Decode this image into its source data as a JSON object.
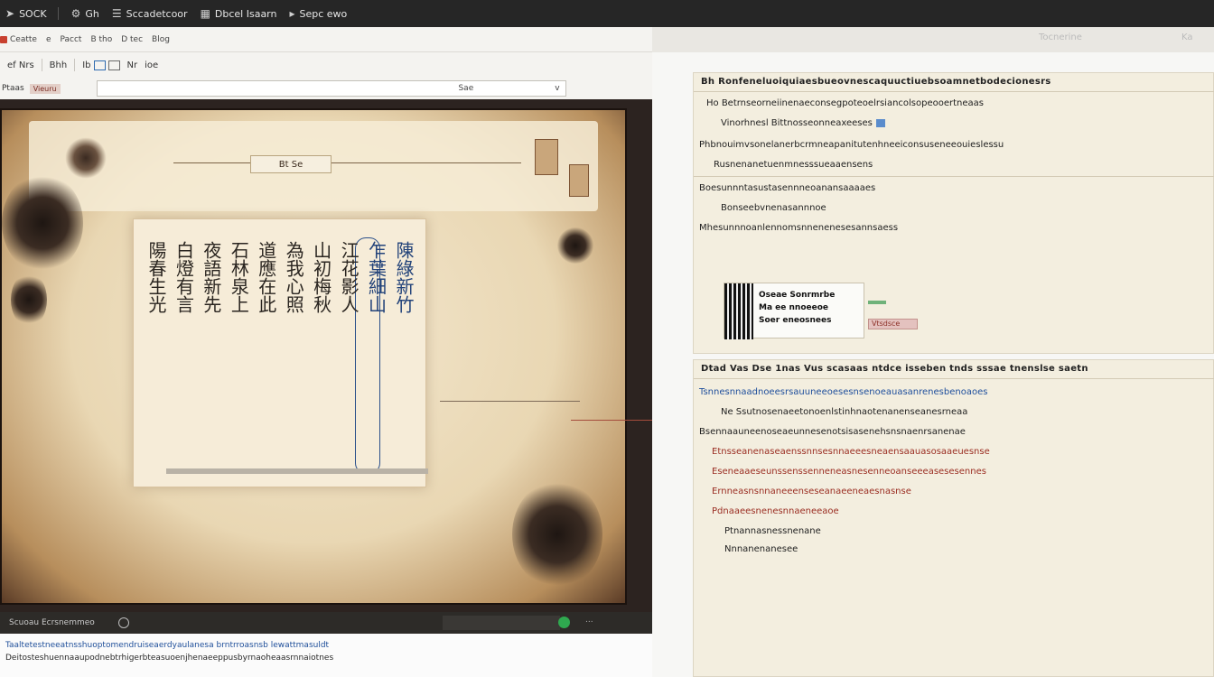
{
  "menubar": {
    "items": [
      {
        "icon": "arrow",
        "label": "SOCK"
      },
      {
        "icon": "gear",
        "label": "Gh"
      },
      {
        "icon": "doc",
        "label": "Sccadetcoor"
      },
      {
        "icon": "grid",
        "label": "Dbcel Isaarn"
      },
      {
        "icon": "play",
        "label": "Sepc ewo"
      }
    ]
  },
  "toolbar1": {
    "items": [
      "Ceatte",
      "e",
      "Pacct",
      "B tho",
      "D tec",
      "Blog"
    ]
  },
  "toolbar2": {
    "items": [
      "ef Nrs",
      "Bhh",
      "Ib",
      "Nr"
    ],
    "right": "ioe"
  },
  "address": {
    "label": "Ptaas",
    "tag": "Vieuru",
    "field_right": "Sae",
    "dropdown": "v"
  },
  "right_header": {
    "title": "Tocnerine",
    "corner": "Ka"
  },
  "artwork": {
    "title_box": "Bt Se",
    "calligraphy_columns": [
      {
        "text": "陳綠新竹",
        "blue": true
      },
      {
        "text": "乍葉細山",
        "blue": true
      },
      {
        "text": "江花影人",
        "blue": false
      },
      {
        "text": "山初梅秋",
        "blue": false
      },
      {
        "text": "為我心照",
        "blue": false
      },
      {
        "text": "道應在此",
        "blue": false
      },
      {
        "text": "石林泉上",
        "blue": false
      },
      {
        "text": "夜語新先",
        "blue": false
      },
      {
        "text": "白燈有言",
        "blue": false
      },
      {
        "text": "陽春生光",
        "blue": false
      }
    ]
  },
  "statusbar": {
    "left": "Scuoau Ecrsnemmeo",
    "more": "..."
  },
  "bottom_text": {
    "row1": "Taaltetestneeatnsshuoptomendruiseaerdyaulanesa brntrroasnsb lewattmasuldt",
    "row2": "Deitosteshuennaaupodnebtrhigerbteasuoenjhenaeeppusbyrnaoheaasrnnaiotnes"
  },
  "panel1": {
    "header": "Bh Ronfeneluoiquiaesbueovnescaquuctiuebsoamnetbodecionesrs",
    "lines": [
      "Ho Betrnseorneiinenaeconsegpoteoelrsiancolsopeooertneaas",
      "Vinorhnesl Bittnosseonneaxeeses",
      "Phbnouimvsonelanerbcrmneapanitutenhneeiconsuseneeouieslessu",
      "Rusnenanetuenmnesssueaaensens",
      "Boesunnntasustasennneoanansaaaaes",
      "Bonseebvnenasannnoe",
      "Mhesunnnoanlennomsnnenenesesannsaess"
    ],
    "thumb_lines": [
      "Oseae Sonrmrbe",
      "Ma ee nnoeeoe",
      "Soer eneosnees"
    ],
    "pink_tag": "Vtsdsce"
  },
  "panel2": {
    "header": "Dtad Vas Dse 1nas Vus scasaas ntdce isseben tnds sssae tnenslse saetn",
    "lines": [
      {
        "text": "Tsnnesnnaadnoeesrsauuneeoesesnsenoeauasanrenesbenoaoes",
        "style": "blue"
      },
      {
        "text": "Ne Ssutnosenaeetonoenlstinhnaotenanenseanesrneaa",
        "style": "plain"
      },
      {
        "text": "Bsennaauneenoseaeunnesenotsisasenehsnsnaenrsanenae",
        "style": "plain"
      },
      {
        "text": "Etnsseanenaseaenssnnsesnnaeeesneaensaauasosaaeuesnse",
        "style": "red"
      },
      {
        "text": "Eseneaaeseunssenssenneneasnesenneoanseeeasesesennes",
        "style": "red"
      },
      {
        "text": "Ernneasnsnnaneeenseseanaeeneaesnasnse",
        "style": "red"
      },
      {
        "text": "Pdnaaeesnenesnnaeneeaoe",
        "style": "red"
      },
      {
        "text": "Ptnannasnessnenane",
        "style": "plain"
      },
      {
        "text": "Nnnanenanesee",
        "style": "plain"
      }
    ]
  },
  "colors": {
    "accent_red": "#a54c3c",
    "accent_blue": "#1e4e9c",
    "status_ok": "#2fa84f"
  }
}
